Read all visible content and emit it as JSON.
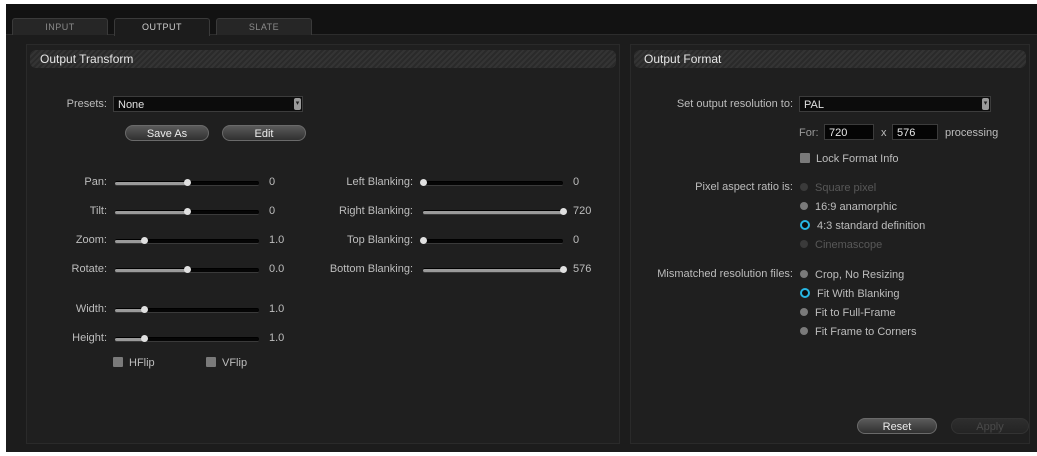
{
  "tabs": [
    {
      "label": "INPUT",
      "active": false
    },
    {
      "label": "OUTPUT",
      "active": true
    },
    {
      "label": "SLATE",
      "active": false
    }
  ],
  "output_transform": {
    "title": "Output Transform",
    "presets_label": "Presets:",
    "presets_value": "None",
    "save_as_label": "Save As",
    "edit_label": "Edit",
    "sliders_left": [
      {
        "label": "Pan:",
        "value": "0",
        "fraction": 0.5
      },
      {
        "label": "Tilt:",
        "value": "0",
        "fraction": 0.5
      },
      {
        "label": "Zoom:",
        "value": "1.0",
        "fraction": 0.2
      },
      {
        "label": "Rotate:",
        "value": "0.0",
        "fraction": 0.5
      },
      {
        "label": "Width:",
        "value": "1.0",
        "fraction": 0.2
      },
      {
        "label": "Height:",
        "value": "1.0",
        "fraction": 0.2
      }
    ],
    "sliders_right": [
      {
        "label": "Left Blanking:",
        "value": "0",
        "fraction": 0.0
      },
      {
        "label": "Right Blanking:",
        "value": "720",
        "fraction": 1.0
      },
      {
        "label": "Top Blanking:",
        "value": "0",
        "fraction": 0.0
      },
      {
        "label": "Bottom Blanking:",
        "value": "576",
        "fraction": 1.0
      }
    ],
    "hflip_label": "HFlip",
    "vflip_label": "VFlip"
  },
  "output_format": {
    "title": "Output Format",
    "resolution_label": "Set output resolution to:",
    "resolution_value": "PAL",
    "for_label": "For:",
    "width_value": "720",
    "x_label": "x",
    "height_value": "576",
    "processing_label": "processing",
    "lock_label": "Lock Format Info",
    "pixel_aspect_label": "Pixel aspect ratio is:",
    "pixel_aspect_options": [
      {
        "label": "Square pixel",
        "selected": false,
        "enabled": false
      },
      {
        "label": "16:9 anamorphic",
        "selected": false,
        "enabled": true
      },
      {
        "label": "4:3 standard definition",
        "selected": true,
        "enabled": true
      },
      {
        "label": "Cinemascope",
        "selected": false,
        "enabled": false
      }
    ],
    "mismatched_label": "Mismatched resolution files:",
    "mismatched_options": [
      {
        "label": "Crop, No Resizing",
        "selected": false,
        "enabled": true
      },
      {
        "label": "Fit With Blanking",
        "selected": true,
        "enabled": true
      },
      {
        "label": "Fit to Full-Frame",
        "selected": false,
        "enabled": true
      },
      {
        "label": "Fit Frame to Corners",
        "selected": false,
        "enabled": true
      }
    ],
    "reset_label": "Reset",
    "apply_label": "Apply"
  },
  "colors": {
    "accent": "#27b6e3",
    "background": "#1c1c1c"
  }
}
